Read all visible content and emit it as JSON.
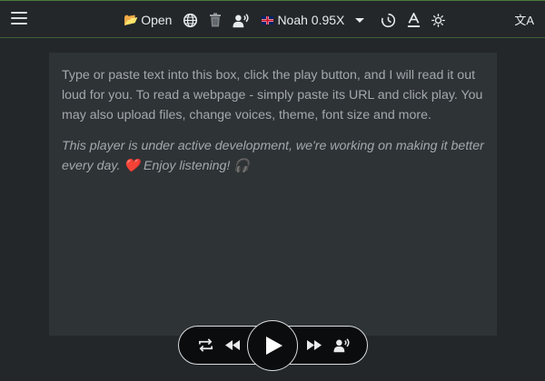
{
  "toolbar": {
    "open_label": "Open",
    "voice_label": "Noah 0.95X",
    "translate_glyph": "文A"
  },
  "icons": {
    "menu": "hamburger-icon",
    "open": "folder-icon",
    "web": "globe-icon",
    "clear": "trash-icon",
    "voice": "speaking-head-icon",
    "flag": "uk-flag-icon",
    "dropdown": "caret-down-icon",
    "speed": "clock-speed-icon",
    "font": "text-color-icon",
    "theme": "sun-icon",
    "translate": "translate-icon"
  },
  "content": {
    "paragraph1": "Type or paste text into this box, click the play button, and I will read it out loud for you. To read a webpage - simply paste its URL and click play. You may also upload files, change voices, theme, font size and more.",
    "paragraph2": "This player is under active development, we're working on making it better every day. ❤️ Enjoy listening! 🎧"
  },
  "colors": {
    "background": "#23272a",
    "textbox": "#2e3336",
    "text": "#a3a8ac",
    "accent_border": "#4a7c3a",
    "player_bg": "#0b0c0d"
  }
}
